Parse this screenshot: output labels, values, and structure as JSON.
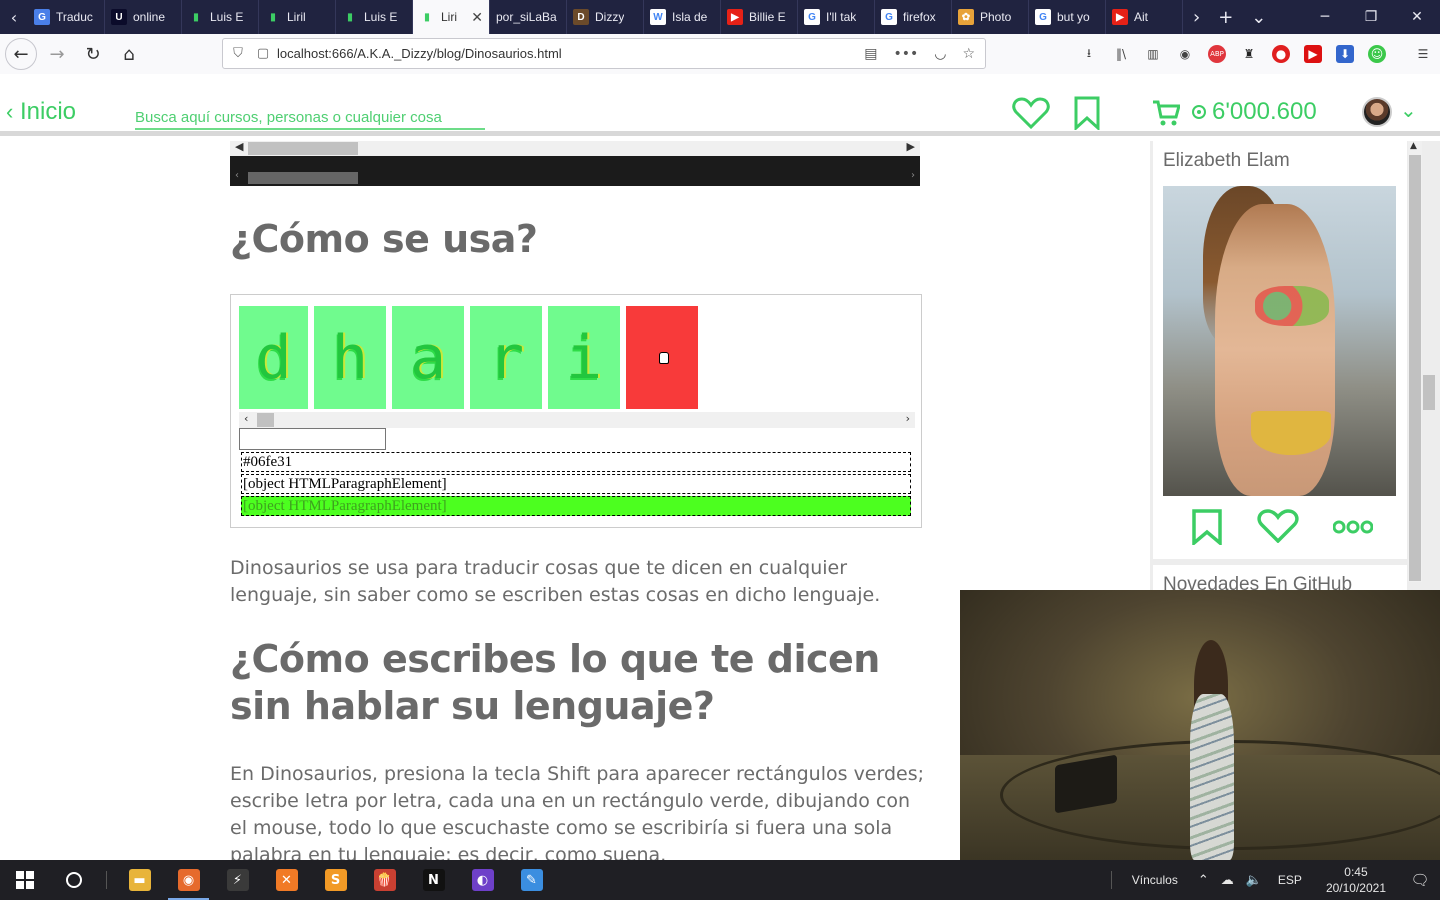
{
  "browser": {
    "tabs": [
      {
        "title": "Traduc",
        "fav": "translate-icon",
        "fav_color": "#4a7fe8",
        "fav_text": "G"
      },
      {
        "title": "online",
        "fav": "u-icon",
        "fav_color": "#0b0b2a",
        "fav_text": "U"
      },
      {
        "title": "Luis E",
        "fav": "bars-icon",
        "fav_color": "#202340",
        "fav_text": "▮"
      },
      {
        "title": "Liril",
        "fav": "bars-icon",
        "fav_color": "#202340",
        "fav_text": "▮"
      },
      {
        "title": "Luis E",
        "fav": "bars-icon",
        "fav_color": "#202340",
        "fav_text": "▮"
      },
      {
        "title": "Liri",
        "fav": "bars-icon",
        "fav_color": "#f9f9fb",
        "fav_text": "▮",
        "active": true
      },
      {
        "title": "por_siLaBa",
        "fav": "",
        "fav_color": "#202340",
        "fav_text": ""
      },
      {
        "title": "Dizzy",
        "fav": "dizzy-icon",
        "fav_color": "#6b4a2a",
        "fav_text": "D"
      },
      {
        "title": "Isla de",
        "fav": "wikipedia-icon",
        "fav_color": "#ffffff",
        "fav_text": "W"
      },
      {
        "title": "Billie E",
        "fav": "youtube-icon",
        "fav_color": "#e62117",
        "fav_text": "▶"
      },
      {
        "title": "I'll tak",
        "fav": "google-icon",
        "fav_color": "#ffffff",
        "fav_text": "G"
      },
      {
        "title": "firefox",
        "fav": "google-icon",
        "fav_color": "#ffffff",
        "fav_text": "G"
      },
      {
        "title": "Photo",
        "fav": "photos-icon",
        "fav_color": "#e8a33a",
        "fav_text": "✿"
      },
      {
        "title": "but yo",
        "fav": "google-icon",
        "fav_color": "#ffffff",
        "fav_text": "G"
      },
      {
        "title": "Ait",
        "fav": "youtube-icon",
        "fav_color": "#e62117",
        "fav_text": "▶"
      }
    ],
    "url": "localhost:666/A.K.A._Dizzy/blog/Dinosaurios.html"
  },
  "header": {
    "home_label": "Inicio",
    "search_placeholder": "Busca aquí cursos, personas o cualquier cosa",
    "coins": "6'000.600",
    "accent": "#3ccd64"
  },
  "article": {
    "heading1": "¿Cómo se usa?",
    "demo": {
      "cards": [
        {
          "glyph": "d",
          "color": "#70fb8e"
        },
        {
          "glyph": "h",
          "color": "#70fb8e"
        },
        {
          "glyph": "a",
          "color": "#70fb8e"
        },
        {
          "glyph": "r",
          "color": "#70fb8e"
        },
        {
          "glyph": "i",
          "color": "#70fb8e"
        },
        {
          "glyph": "",
          "color": "#f83a3a"
        }
      ],
      "color_value": "#06fe31",
      "line2": "[object HTMLParagraphElement]",
      "line3": "[object HTMLParagraphElement]",
      "highlight_color": "#4cff1f"
    },
    "para1": "Dinosaurios se usa para traducir cosas que te dicen en cualquier lenguaje, sin saber como se escriben estas cosas en dicho lenguaje.",
    "heading2": "¿Cómo escribes lo que te dicen sin hablar su lenguaje?",
    "para2": "En Dinosaurios, presiona la tecla Shift para aparecer rectángulos verdes; escribe letra por letra, cada una en un rectángulo verde, dibujando con el mouse, todo lo que escuchaste como se escribiría si fuera una sola palabra en tu lenguaje; es decir, como suena."
  },
  "sidebar": {
    "profile_name": "Elizabeth Elam",
    "github_title": "Novedades En GitHub"
  },
  "taskbar": {
    "apps": [
      {
        "name": "file-explorer-icon",
        "color": "#e8b43a",
        "text": "▬"
      },
      {
        "name": "firefox-icon",
        "color": "#e66a2c",
        "text": "◉",
        "active": true
      },
      {
        "name": "winrar-icon",
        "color": "#3a3a3a",
        "text": "⚡"
      },
      {
        "name": "xampp-icon",
        "color": "#f17a26",
        "text": "✕"
      },
      {
        "name": "sublime-icon",
        "color": "#f29a26",
        "text": "S"
      },
      {
        "name": "popcorn-icon",
        "color": "#c94032",
        "text": "🍿"
      },
      {
        "name": "netflix-icon",
        "color": "#111111",
        "text": "N"
      },
      {
        "name": "github-desktop-icon",
        "color": "#6e40c9",
        "text": "◐"
      },
      {
        "name": "paint-icon",
        "color": "#3b8ee0",
        "text": "✎"
      }
    ],
    "links_label": "Vínculos",
    "language": "ESP",
    "time": "0:45",
    "date": "20/10/2021"
  }
}
